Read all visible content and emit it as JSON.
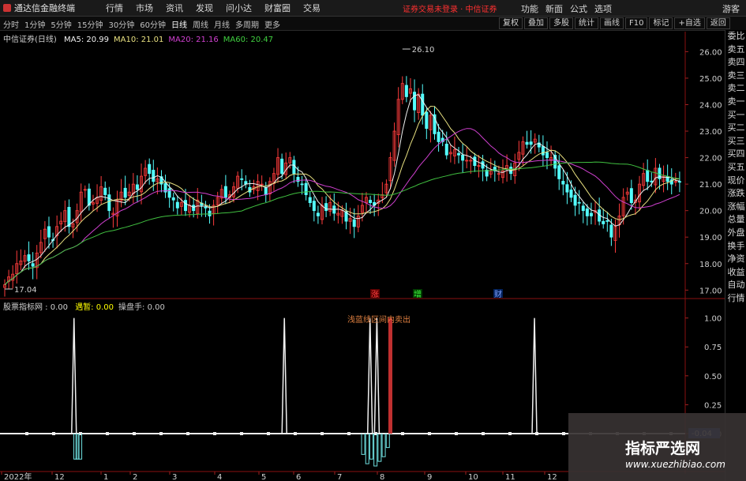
{
  "app": {
    "title": "通达信金融终端"
  },
  "menu": [
    "行情",
    "市场",
    "资讯",
    "发现",
    "问小达",
    "财富圈",
    "交易"
  ],
  "notice": "证券交易未登录 · 中信证券",
  "right_menu": [
    "功能",
    "新面",
    "公式",
    "选项"
  ],
  "guest": "游客",
  "periods": [
    "分时",
    "1分钟",
    "5分钟",
    "15分钟",
    "30分钟",
    "60分钟",
    "日线",
    "周线",
    "月线",
    "多周期",
    "更多"
  ],
  "active_period": "日线",
  "toolbar": [
    "复权",
    "叠加",
    "多股",
    "统计",
    "画线",
    "F10",
    "标记",
    "+自选",
    "返回"
  ],
  "stock": {
    "name": "中信证券(日线)"
  },
  "ma": [
    {
      "label": "MA5: 20.99",
      "color": "#f0f0f0"
    },
    {
      "label": "MA10: 21.01",
      "color": "#e8e080"
    },
    {
      "label": "MA20: 21.16",
      "color": "#d040d0"
    },
    {
      "label": "MA60: 20.47",
      "color": "#40d040"
    }
  ],
  "indicator": {
    "name": "股票指标网 : 0.00",
    "vals": [
      {
        "label": "遇暂: 0.00",
        "color": "#ffff00"
      },
      {
        "label": "操盘手: 0.00",
        "color": "#c8c8c8"
      }
    ],
    "annotation": "浅蓝线区间内卖出",
    "readout": "-0.04"
  },
  "markers": [
    {
      "text": "涨",
      "color": "#ff4040",
      "bg": "#5a0000"
    },
    {
      "text": "增",
      "color": "#40ff40",
      "bg": "#003a00"
    },
    {
      "text": "财",
      "color": "#80a0ff",
      "bg": "#00205a"
    }
  ],
  "side_tabs": [
    "委比",
    "卖五",
    "卖四",
    "卖三",
    "卖二",
    "卖一",
    "买一",
    "买二",
    "买三",
    "买四",
    "买五",
    "现价",
    "涨跌",
    "涨幅",
    "总量",
    "外盘",
    "换手",
    "净资",
    "收益",
    "自动",
    "行情"
  ],
  "watermark": {
    "cn": "指标严选网",
    "url": "www.xuezhibiao.com"
  },
  "chart_data": {
    "type": "candlestick",
    "price_axis": {
      "ylim": [
        16.8,
        26.4
      ],
      "ticks": [
        "26.00",
        "25.00",
        "24.00",
        "23.00",
        "22.00",
        "21.00",
        "20.00",
        "19.00",
        "18.00",
        "17.00"
      ]
    },
    "indicator_axis": {
      "ylim": [
        -0.28,
        1.1
      ],
      "ticks": [
        "1.00",
        "0.75",
        "0.50",
        "0.25",
        "0.00"
      ]
    },
    "x_labels": [
      "2022年",
      "12",
      "1",
      "2",
      "3",
      "4",
      "5",
      "6",
      "7",
      "8",
      "9",
      "10",
      "11",
      "12"
    ],
    "closes": [
      17.2,
      17.5,
      17.6,
      18,
      18.1,
      18.3,
      18.1,
      17.9,
      18.4,
      18.8,
      19.3,
      19.0,
      18.9,
      19.4,
      19.6,
      20.0,
      19.4,
      19.5,
      20.0,
      20.7,
      20.8,
      20.2,
      20.3,
      20.5,
      20.9,
      20.6,
      20.0,
      19.9,
      20.4,
      20.7,
      20.5,
      20.7,
      21.0,
      20.8,
      21.3,
      21.6,
      21.4,
      21.1,
      21.2,
      21.0,
      20.7,
      20.5,
      20.4,
      20.1,
      20.3,
      20.0,
      20.2,
      20.0,
      20.4,
      20.2,
      20.1,
      19.8,
      20.2,
      20.5,
      20.8,
      20.5,
      20.6,
      20.9,
      21.3,
      21.2,
      21.0,
      20.7,
      20.9,
      21.1,
      21.0,
      20.6,
      21.1,
      21.4,
      22.0,
      21.4,
      21.8,
      22.0,
      21.4,
      21.1,
      21.0,
      20.6,
      20.3,
      20.0,
      19.8,
      20.2,
      20.0,
      20.3,
      19.9,
      19.9,
      20.0,
      19.6,
      19.7,
      19.4,
      19.8,
      20.2,
      20.5,
      20.3,
      20.2,
      20.4,
      20.6,
      21.0,
      22.0,
      23.0,
      24.2,
      24.8,
      24.3,
      24.6,
      23.8,
      24.4,
      23.6,
      23.1,
      23.6,
      22.9,
      22.6,
      22.6,
      22.1,
      22.2,
      22.3,
      22.1,
      21.9,
      21.9,
      21.9,
      21.7,
      21.7,
      21.6,
      21.3,
      21.5,
      21.5,
      21.4,
      21.5,
      21.7,
      21.4,
      21.8,
      22.2,
      22.6,
      22.5,
      22.5,
      22.7,
      22.4,
      22.1,
      22.0,
      22.0,
      21.6,
      21.2,
      21.0,
      20.7,
      20.5,
      20.2,
      20.3,
      20.0,
      19.8,
      19.8,
      20.0,
      19.6,
      19.5,
      19.6,
      19.0,
      19.4,
      19.8,
      20.5,
      20.7,
      20.3,
      20.4,
      21.0,
      21.4,
      21.1,
      21.1,
      21.6,
      21.2,
      21.3,
      21.1,
      21.0,
      21.1,
      21.1
    ],
    "price_high": 26.1,
    "price_low": 17.04,
    "ma5": 20.99,
    "ma10": 21.01,
    "ma20": 21.16,
    "ma60": 20.47,
    "indicator_spikes": [
      {
        "x": 0.108,
        "value": 1.0
      },
      {
        "x": 0.415,
        "value": 1.0
      },
      {
        "x": 0.54,
        "value": 1.0
      },
      {
        "x": 0.55,
        "value": 1.0
      },
      {
        "x": 0.78,
        "value": 1.0
      }
    ],
    "indicator_dips": [
      {
        "x": 0.11,
        "value": -0.22
      },
      {
        "x": 0.113,
        "value": -0.22
      },
      {
        "x": 0.117,
        "value": -0.22
      },
      {
        "x": 0.53,
        "value": -0.18
      },
      {
        "x": 0.536,
        "value": -0.26
      },
      {
        "x": 0.542,
        "value": -0.22
      },
      {
        "x": 0.548,
        "value": -0.28
      },
      {
        "x": 0.554,
        "value": -0.24
      },
      {
        "x": 0.56,
        "value": -0.2
      },
      {
        "x": 0.566,
        "value": -0.12
      }
    ]
  }
}
